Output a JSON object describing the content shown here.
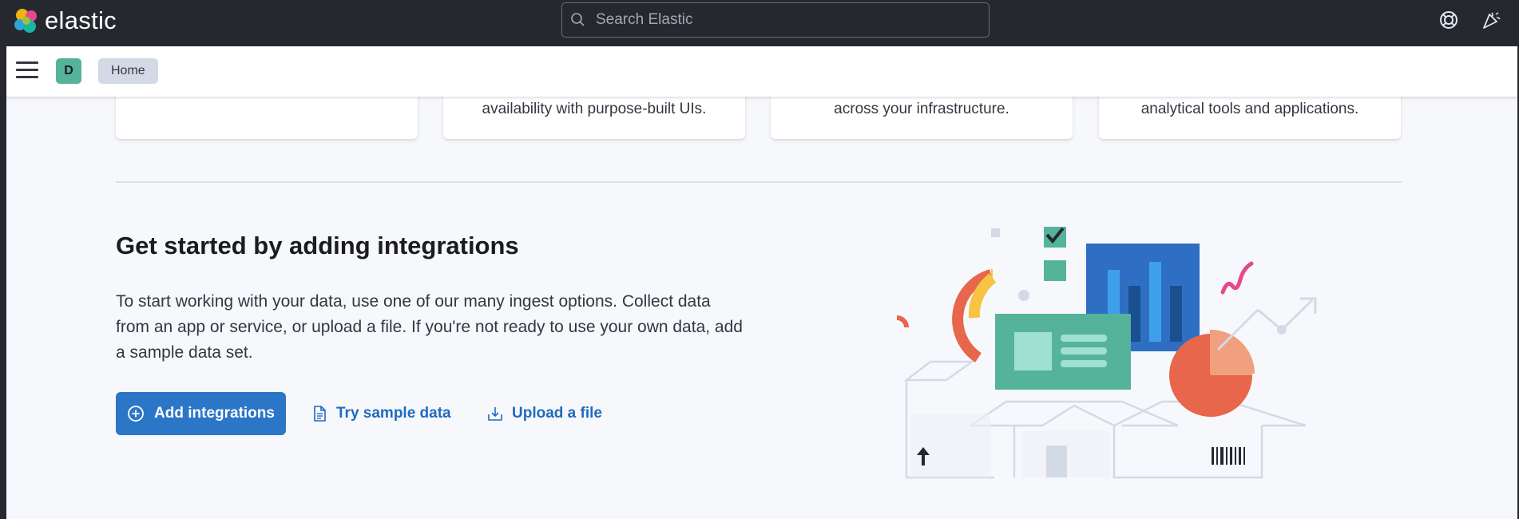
{
  "header": {
    "brand": "elastic",
    "search_placeholder": "Search Elastic"
  },
  "subheader": {
    "avatar_initial": "D",
    "breadcrumb": "Home"
  },
  "cards": [
    {
      "text": ""
    },
    {
      "text": "availability with purpose-built UIs."
    },
    {
      "text": "across your infrastructure."
    },
    {
      "text": "analytical tools and applications."
    }
  ],
  "integrations": {
    "title": "Get started by adding integrations",
    "description": "To start working with your data, use one of our many ingest options. Collect data from an app or service, or upload a file. If you're not ready to use your own data, add a sample data set.",
    "primary_button": "Add integrations",
    "sample_link": "Try sample data",
    "upload_link": "Upload a file"
  },
  "icons": {
    "logo": "elastic-logo-icon",
    "search": "search-icon",
    "help": "help-lifebuoy-icon",
    "news": "newsfeed-cheer-icon",
    "menu": "hamburger-menu-icon",
    "add": "plus-circle-icon",
    "sample": "document-icon",
    "upload": "download-tray-icon"
  },
  "colors": {
    "header_bg": "#25282f",
    "primary": "#2b76c7",
    "link": "#1f6bbf",
    "avatar": "#54b399"
  }
}
